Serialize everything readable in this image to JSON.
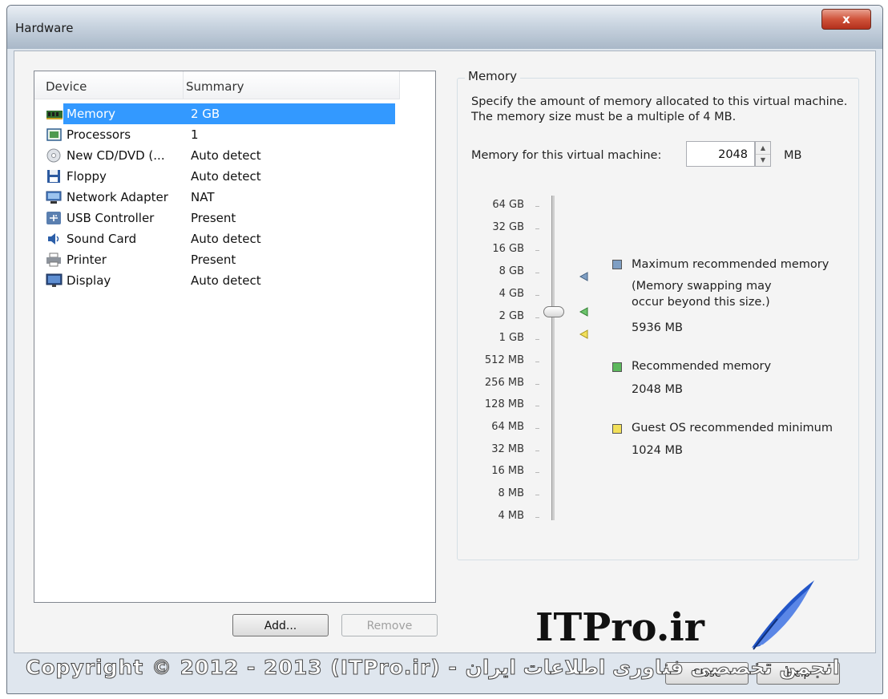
{
  "window": {
    "title": "Hardware",
    "close_label": "x"
  },
  "device_list": {
    "headers": {
      "device": "Device",
      "summary": "Summary"
    },
    "rows": [
      {
        "device": "Memory",
        "summary": "2 GB",
        "icon": "memory-icon",
        "selected": true
      },
      {
        "device": "Processors",
        "summary": "1",
        "icon": "processor-icon"
      },
      {
        "device": "New CD/DVD (...",
        "summary": "Auto detect",
        "icon": "cd-dvd-icon"
      },
      {
        "device": "Floppy",
        "summary": "Auto detect",
        "icon": "floppy-icon"
      },
      {
        "device": "Network Adapter",
        "summary": "NAT",
        "icon": "network-adapter-icon"
      },
      {
        "device": "USB Controller",
        "summary": "Present",
        "icon": "usb-icon"
      },
      {
        "device": "Sound Card",
        "summary": "Auto detect",
        "icon": "sound-card-icon"
      },
      {
        "device": "Printer",
        "summary": "Present",
        "icon": "printer-icon"
      },
      {
        "device": "Display",
        "summary": "Auto detect",
        "icon": "display-icon"
      }
    ],
    "add_label": "Add...",
    "remove_label": "Remove"
  },
  "memory": {
    "group_label": "Memory",
    "description": "Specify the amount of memory allocated to this virtual machine. The memory size must be a multiple of 4 MB.",
    "field_label": "Memory for this virtual machine:",
    "value": "2048",
    "unit": "MB",
    "scale": [
      "64 GB",
      "32 GB",
      "16 GB",
      "8 GB",
      "4 GB",
      "2 GB",
      "1 GB",
      "512 MB",
      "256 MB",
      "128 MB",
      "64 MB",
      "32 MB",
      "16 MB",
      "8 MB",
      "4 MB"
    ],
    "legend": {
      "max": {
        "label": "Maximum recommended memory",
        "note_line1": "(Memory swapping may",
        "note_line2": "occur beyond this size.)",
        "value": "5936 MB",
        "color": "#7f9fc4"
      },
      "recommended": {
        "label": "Recommended memory",
        "value": "2048 MB",
        "color": "#5cb85c"
      },
      "guest_min": {
        "label": "Guest OS recommended minimum",
        "value": "1024 MB",
        "color": "#f2e05a"
      }
    }
  },
  "watermark": {
    "logo": "ITPro.ir",
    "copyright": "Copyright © 2012 - 2013 (ITPro.ir) - انجمن تخصصی فناوری اطلاعات ایران"
  },
  "footer": {
    "close_label": "Close",
    "help_label": "Help"
  }
}
